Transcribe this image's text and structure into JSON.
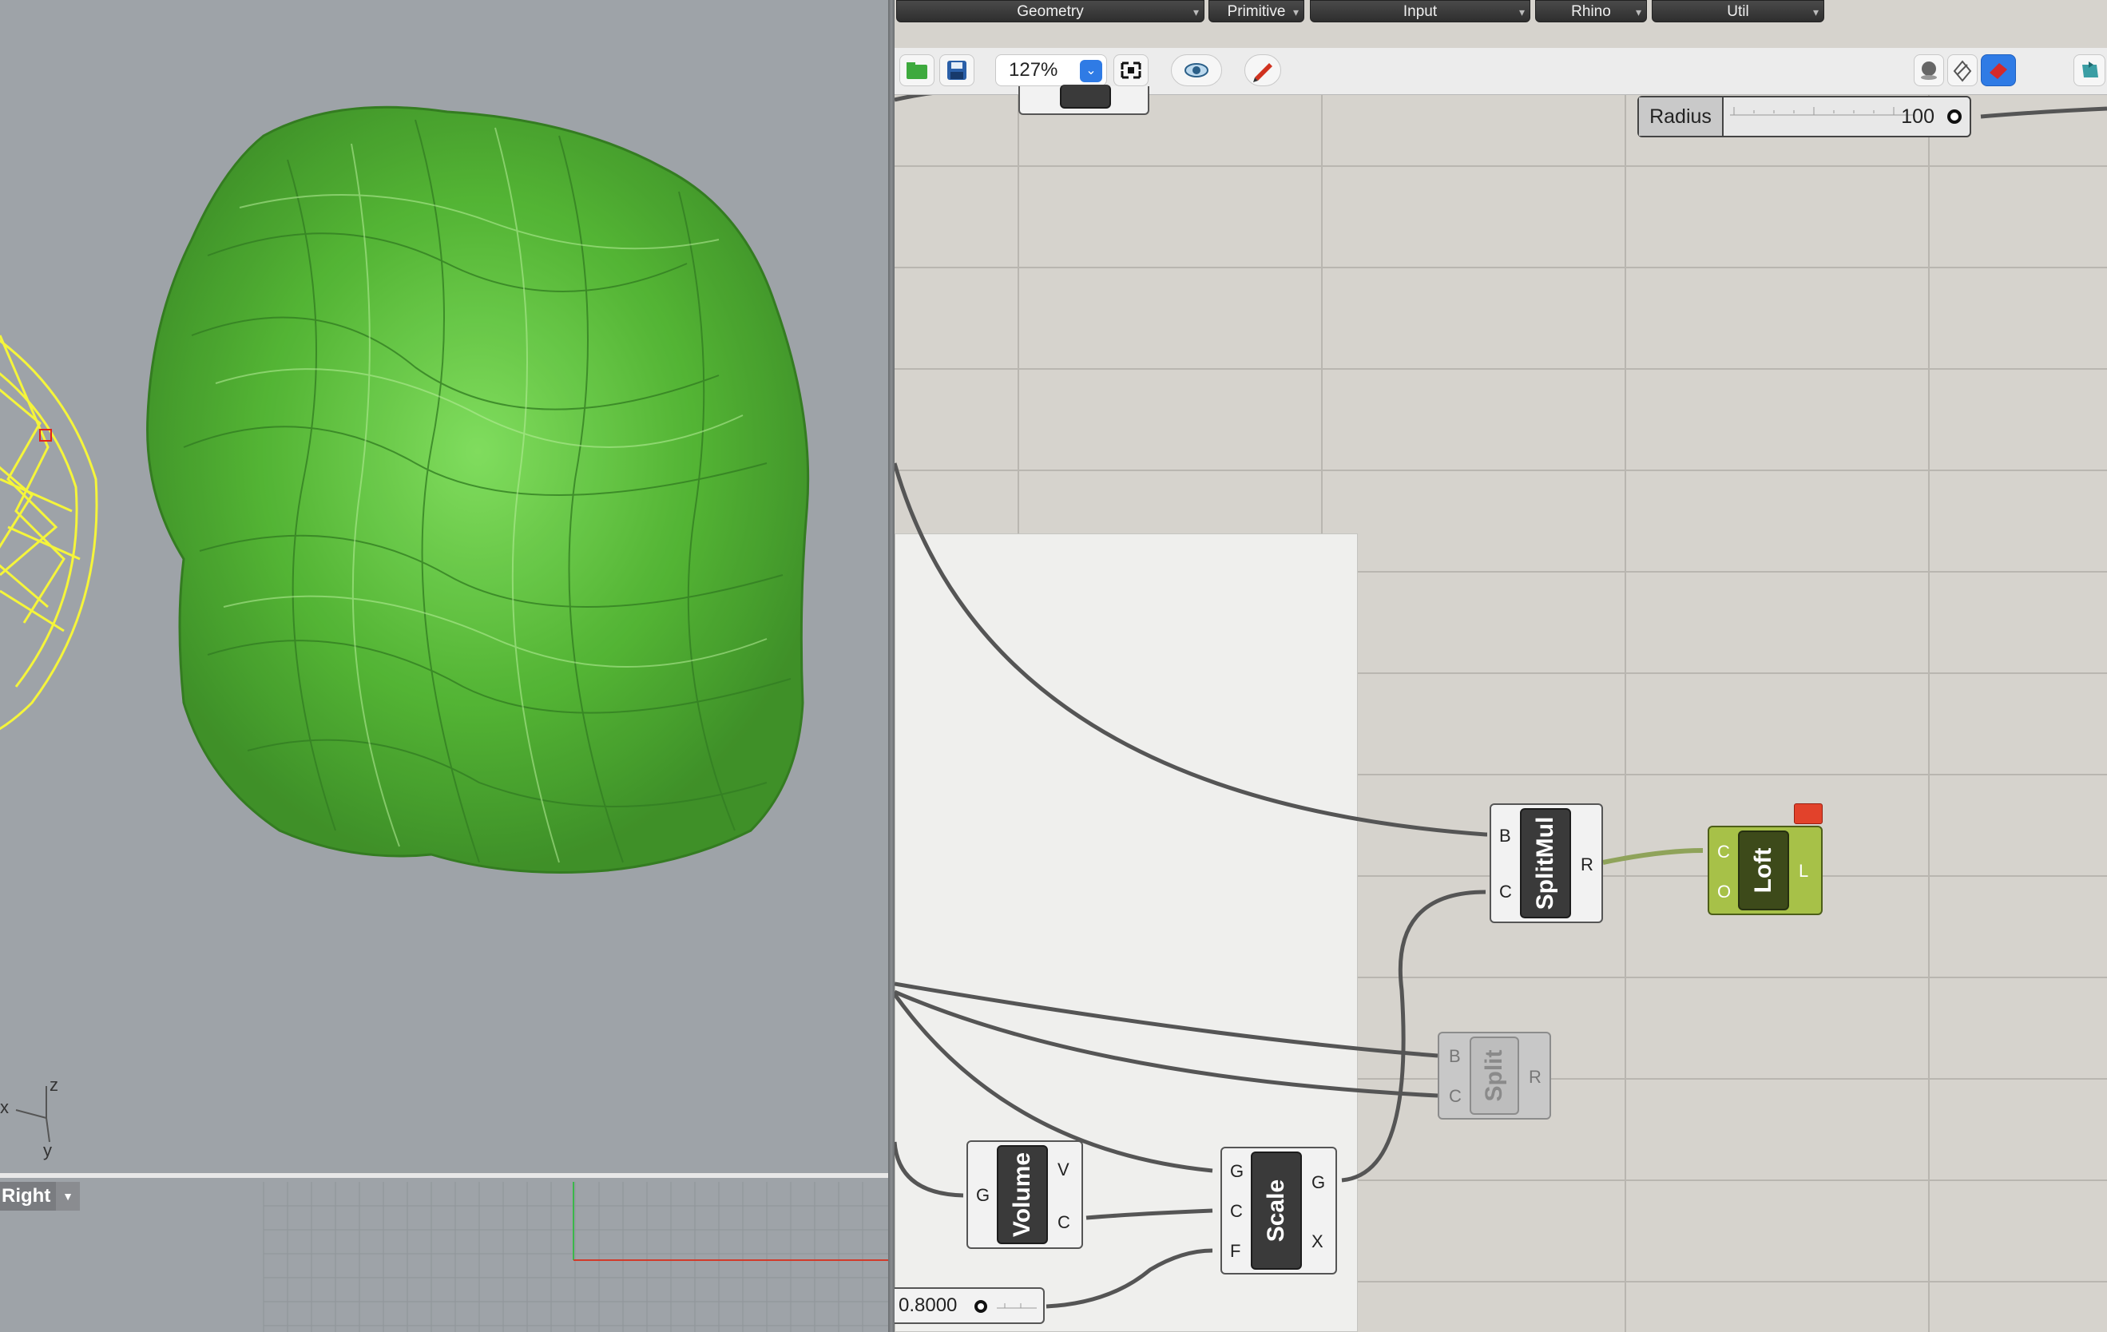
{
  "viewport": {
    "view_name": "Right",
    "axis_labels": {
      "x": "x",
      "y": "y",
      "z": "z"
    }
  },
  "tabs": [
    {
      "label": "Geometry"
    },
    {
      "label": "Primitive"
    },
    {
      "label": "Input"
    },
    {
      "label": "Rhino"
    },
    {
      "label": "Util"
    }
  ],
  "toolbar": {
    "zoom": "127%"
  },
  "sliders": {
    "radius": {
      "label": "Radius",
      "value": "100"
    },
    "factor": {
      "value": "0.8000"
    }
  },
  "components": {
    "splitmul": {
      "name": "SplitMul",
      "inputs": [
        "B",
        "C"
      ],
      "outputs": [
        "R"
      ]
    },
    "loft": {
      "name": "Loft",
      "inputs": [
        "C",
        "O"
      ],
      "outputs": [
        "L"
      ]
    },
    "split": {
      "name": "Split",
      "inputs": [
        "B",
        "C"
      ],
      "outputs": [
        "R"
      ]
    },
    "volume": {
      "name": "Volume",
      "inputs": [
        "G"
      ],
      "outputs": [
        "V",
        "C"
      ]
    },
    "scale": {
      "name": "Scale",
      "inputs": [
        "G",
        "C",
        "F"
      ],
      "outputs": [
        "G",
        "X"
      ]
    }
  },
  "colors": {
    "mesh_green": "#5cc23c",
    "wire_yellow": "#f5f53a",
    "loft_green": "#a7c148",
    "canvas_bg": "#d6d3cd"
  }
}
